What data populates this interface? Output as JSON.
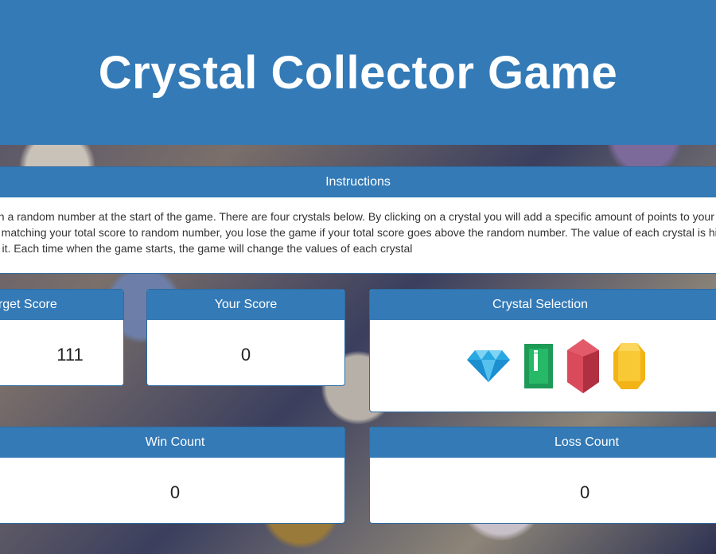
{
  "header": {
    "title": "Crystal Collector Game"
  },
  "instructions": {
    "heading": "Instructions",
    "line1": "ven a random number at the start of the game. There are four crystals below. By clicking on a crystal you will add a specific amount of points to your total",
    "line2": " by matching your total score to random number, you lose the game if your total score goes above the random number. The value of each crystal is hidde",
    "line3": " on it. Each time when the game starts, the game will change the values of each crystal"
  },
  "target": {
    "heading": "arget Score",
    "value": "111"
  },
  "your_score": {
    "heading": "Your Score",
    "value": "0"
  },
  "crystal_selection": {
    "heading": "Crystal Selection",
    "crystals": [
      "blue-diamond-icon",
      "green-emerald-icon",
      "red-ruby-icon",
      "yellow-topaz-icon"
    ]
  },
  "wins": {
    "heading": "Win Count",
    "value": "0"
  },
  "losses": {
    "heading": "Loss Count",
    "value": "0"
  },
  "colors": {
    "primary": "#337ab7",
    "border": "#2e6da4"
  }
}
